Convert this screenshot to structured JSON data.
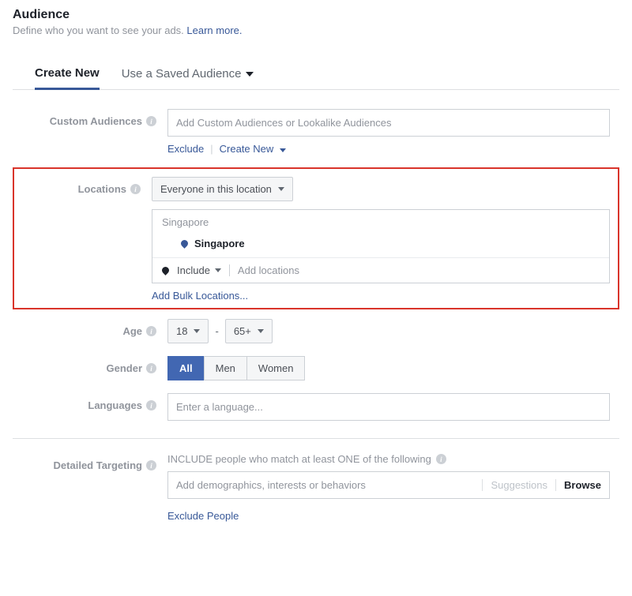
{
  "header": {
    "title": "Audience",
    "subtitle_text": "Define who you want to see your ads. ",
    "learn_more": "Learn more."
  },
  "tabs": {
    "create_new": "Create New",
    "saved": "Use a Saved Audience"
  },
  "custom_audiences": {
    "label": "Custom Audiences",
    "placeholder": "Add Custom Audiences or Lookalike Audiences",
    "exclude": "Exclude",
    "create_new": "Create New"
  },
  "locations": {
    "label": "Locations",
    "scope": "Everyone in this location",
    "group": "Singapore",
    "selected": "Singapore",
    "include_label": "Include",
    "add_placeholder": "Add locations",
    "bulk": "Add Bulk Locations..."
  },
  "age": {
    "label": "Age",
    "min": "18",
    "max": "65+"
  },
  "gender": {
    "label": "Gender",
    "all": "All",
    "men": "Men",
    "women": "Women"
  },
  "languages": {
    "label": "Languages",
    "placeholder": "Enter a language..."
  },
  "detailed": {
    "label": "Detailed Targeting",
    "include_heading": "INCLUDE people who match at least ONE of the following",
    "placeholder": "Add demographics, interests or behaviors",
    "suggestions": "Suggestions",
    "browse": "Browse",
    "exclude": "Exclude People"
  }
}
